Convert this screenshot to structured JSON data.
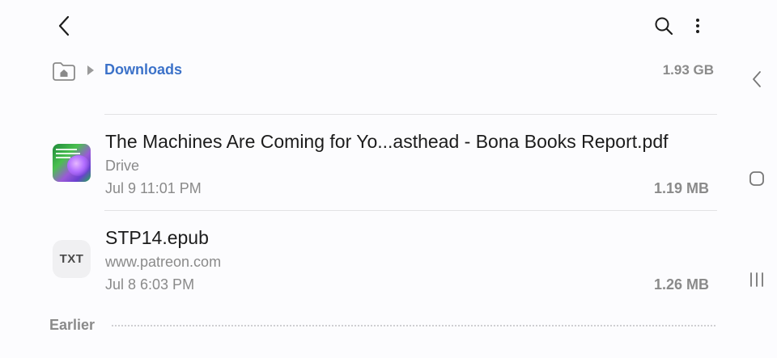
{
  "breadcrumb": {
    "current_folder": "Downloads",
    "storage_size": "1.93 GB"
  },
  "icons": {
    "back": "back-arrow-icon",
    "search": "search-icon",
    "more": "more-vert-icon",
    "home": "folder-home-icon",
    "crumb_arrow": "triangle-right-icon"
  },
  "colors": {
    "accent": "#3c72c9",
    "secondary_text": "#8a8a8a",
    "primary_text": "#1c1c1c",
    "background": "#fcfcfe"
  },
  "files": [
    {
      "title": "The Machines Are Coming for Yo...asthead - Bona Books Report.pdf",
      "source": "Drive",
      "date": "Jul 9 11:01 PM",
      "size": "1.19 MB",
      "thumbnail": "pdf-preview"
    },
    {
      "title": "STP14.epub",
      "source": "www.patreon.com",
      "date": "Jul 8 6:03 PM",
      "size": "1.26 MB",
      "thumbnail_label": "TXT"
    }
  ],
  "section": {
    "label": "Earlier"
  }
}
